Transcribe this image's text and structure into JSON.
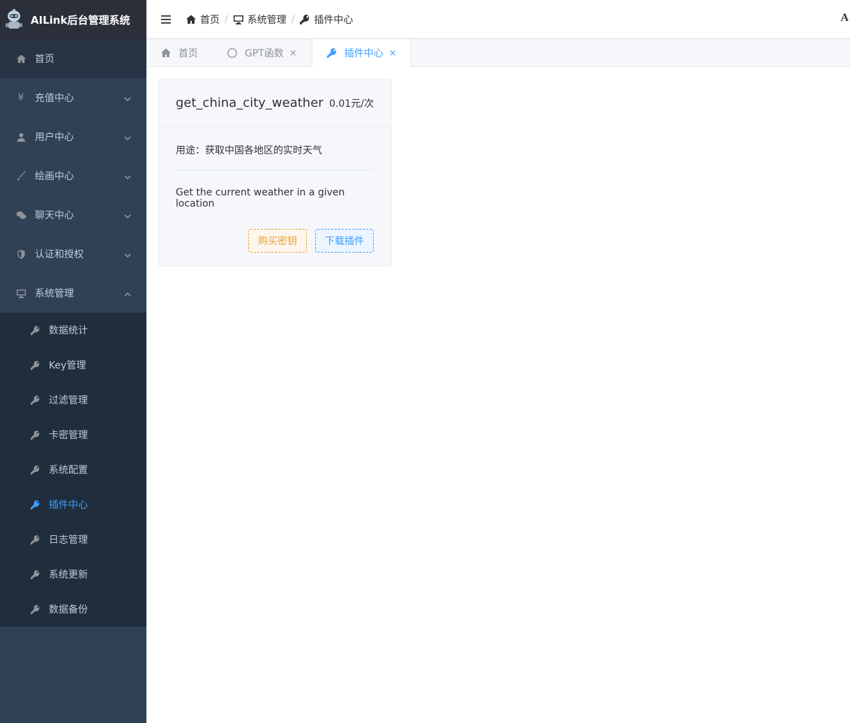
{
  "app": {
    "title": "AILink后台管理系统"
  },
  "sidebar": {
    "items": [
      {
        "label": "首页",
        "icon": "home-icon"
      },
      {
        "label": "充值中心",
        "icon": "yen-icon"
      },
      {
        "label": "用户中心",
        "icon": "user-icon"
      },
      {
        "label": "绘画中心",
        "icon": "brush-icon"
      },
      {
        "label": "聊天中心",
        "icon": "chat-icon"
      },
      {
        "label": "认证和授权",
        "icon": "shield-icon"
      },
      {
        "label": "系统管理",
        "icon": "monitor-icon"
      }
    ],
    "system_submenu": [
      {
        "label": "数据统计"
      },
      {
        "label": "Key管理"
      },
      {
        "label": "过滤管理"
      },
      {
        "label": "卡密管理"
      },
      {
        "label": "系统配置"
      },
      {
        "label": "插件中心"
      },
      {
        "label": "日志管理"
      },
      {
        "label": "系统更新"
      },
      {
        "label": "数据备份"
      }
    ]
  },
  "navbar": {
    "breadcrumb": [
      "首页",
      "系统管理",
      "插件中心"
    ],
    "separator": "/",
    "right_text": "A"
  },
  "tags": [
    {
      "label": "首页",
      "closable": false
    },
    {
      "label": "GPT函数",
      "close": "×"
    },
    {
      "label": "插件中心",
      "close": "×"
    }
  ],
  "plugin_card": {
    "name": "get_china_city_weather",
    "price": "0.01元/次",
    "usage": "用途：获取中国各地区的实时天气",
    "description": "Get the current weather in a given location",
    "buy_button": "购买密钥",
    "download_button": "下载插件"
  },
  "colors": {
    "sidebar_bg": "#304156",
    "submenu_bg": "#1f2d3d",
    "active": "#409eff",
    "warning": "#e6a23c"
  }
}
